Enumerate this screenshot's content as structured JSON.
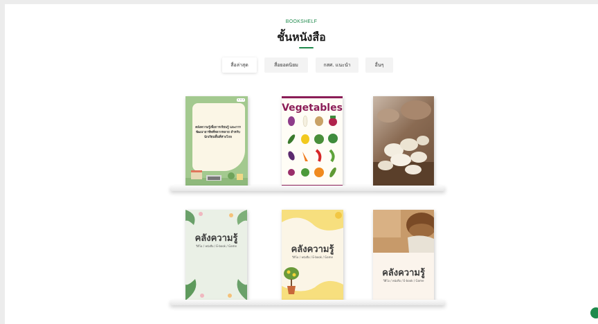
{
  "header": {
    "eyebrow": "BOOKSHELF",
    "title": "ชั้นหนังสือ"
  },
  "tabs": [
    {
      "label": "สื่อล่าสุด",
      "active": true
    },
    {
      "label": "สื่อยอดนิยม",
      "active": false
    },
    {
      "label": "กสศ. แนะนำ",
      "active": false
    },
    {
      "label": "อื่นๆ",
      "active": false
    }
  ],
  "books": [
    {
      "title": "คลังความรู้เพื่อการเรียนรู้ และการพัฒนาอาชีพที่หลากหลาย สำหรับนักเรียนพื้นที่ห่างไกล",
      "badge": "✦ ✦ ✦"
    },
    {
      "title": "Vegetables"
    },
    {
      "title": ""
    },
    {
      "title": "คลังความรู้",
      "subtitle": "วีดีโอ / หนังสือ / E-book / Game"
    },
    {
      "title": "คลังความรู้",
      "subtitle": "วีดีโอ / หนังสือ / E-book / Game"
    },
    {
      "title": "คลังความรู้",
      "subtitle": "วีดีโอ / หนังสือ / E-book / Game"
    }
  ],
  "colors": {
    "accent": "#1f8a4c",
    "vegetables_border": "#8b1d57"
  },
  "icons": {
    "fab": "chat-icon"
  }
}
